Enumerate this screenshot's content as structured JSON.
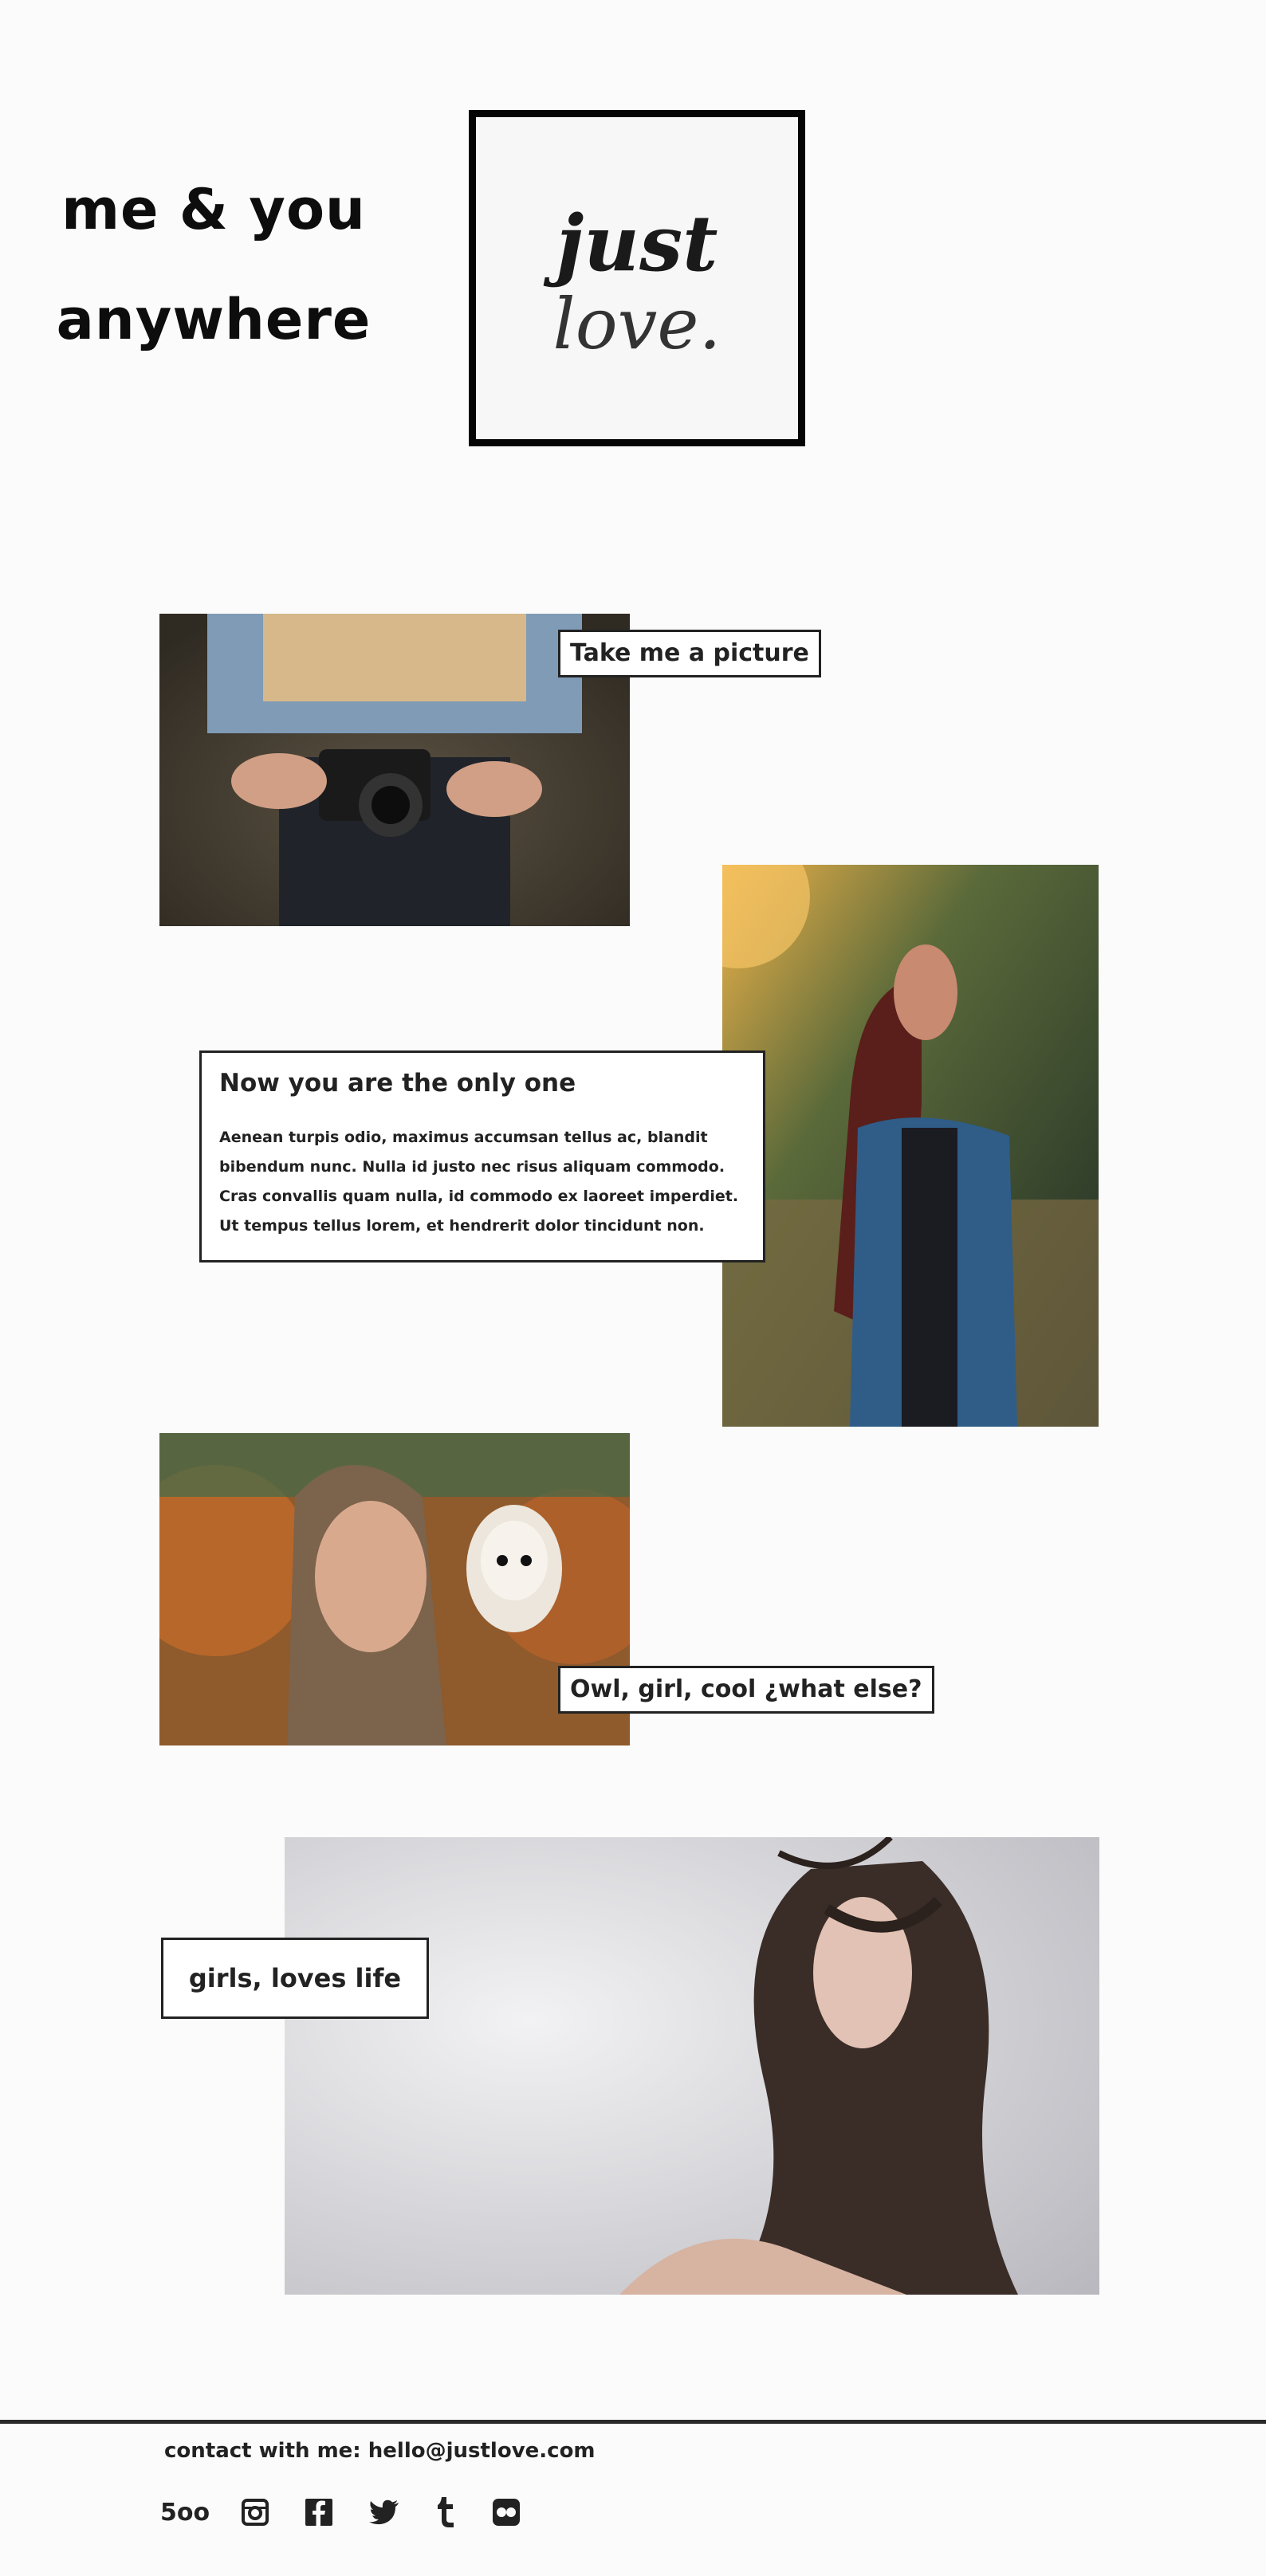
{
  "hero": {
    "line1": "me & you",
    "line2": "anywhere",
    "logo_text1": "just",
    "logo_text2": "love."
  },
  "sections": {
    "camera_caption": "Take me a picture",
    "feature_title": "Now you are the only one",
    "feature_body": "Aenean turpis odio, maximus accumsan tellus ac, blandit bibendum nunc. Nulla id justo nec risus aliquam commodo. Cras convallis quam nulla, id commodo ex laoreet imperdiet. Ut tempus tellus lorem, et hendrerit dolor tincidunt non.",
    "owl_caption": "Owl, girl, cool ¿what else?",
    "hair_caption": "girls, loves life"
  },
  "footer": {
    "contact_label": "contact with me:",
    "contact_email": "hello@justlove.com",
    "social_icons": [
      "500px-icon",
      "instagram-icon",
      "facebook-icon",
      "twitter-icon",
      "tumblr-icon",
      "flickr-icon"
    ],
    "social_500_text": "5oo"
  },
  "colors": {
    "background": "#fbfbfb",
    "ink": "#222222",
    "frame": "#050505"
  }
}
